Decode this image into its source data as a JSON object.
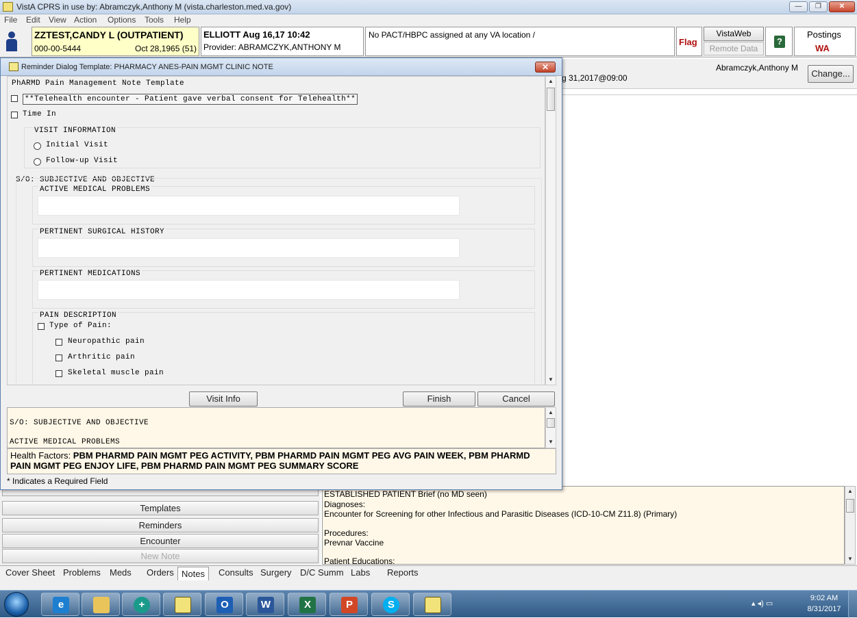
{
  "window": {
    "title": "VistA CPRS in use by: Abramczyk,Anthony M  (vista.charleston.med.va.gov)",
    "controls": [
      "—",
      "❐",
      "✕"
    ]
  },
  "menu": [
    "File",
    "Edit",
    "View",
    "Action",
    "Options",
    "Tools",
    "Help"
  ],
  "patient": {
    "name": "ZZTEST,CANDY L (OUTPATIENT)",
    "ssn": "000-00-5444",
    "dob": "Oct 28,1965 (51)"
  },
  "provider": {
    "line1": "ELLIOTT Aug 16,17 10:42",
    "line2": "Provider:  ABRAMCZYK,ANTHONY M"
  },
  "pact": "No PACT/HBPC assigned at any VA location /",
  "flag": "Flag",
  "vistaweb": "VistaWeb",
  "remote_data": "Remote Data",
  "postings": {
    "label": "Postings",
    "value": "WA"
  },
  "background": {
    "user": "Abramczyk,Anthony M",
    "date_fragment": "g 31,2017@09:00",
    "change_button": "Change..."
  },
  "dialog": {
    "title": "Reminder Dialog Template: PHARMACY ANES-PAIN MGMT CLINIC NOTE",
    "template_title": "PhARMD Pain Management Note Template",
    "telehealth": "**Telehealth encounter - Patient gave verbal consent for Telehealth**",
    "time_in": "Time In",
    "visit_info_group": "VISIT INFORMATION",
    "initial_visit": "Initial Visit",
    "followup_visit": "Follow-up Visit",
    "so_header": "S/O: SUBJECTIVE AND OBJECTIVE",
    "active_problems": "ACTIVE MEDICAL PROBLEMS",
    "surgical_history": "PERTINENT SURGICAL HISTORY",
    "medications": "PERTINENT MEDICATIONS",
    "pain_description": "PAIN DESCRIPTION",
    "type_of_pain": "Type of Pain:",
    "pain_types": [
      "Neuropathic pain",
      "Arthritic pain",
      "Skeletal muscle pain"
    ],
    "buttons": {
      "visit_info": "Visit Info",
      "finish": "Finish",
      "cancel": "Cancel"
    },
    "preview_line1": "S/O: SUBJECTIVE AND OBJECTIVE",
    "preview_line2": "ACTIVE MEDICAL PROBLEMS",
    "health_factors_label": "Health Factors:",
    "health_factors": "PBM PHARMD PAIN MGMT PEG ACTIVITY, PBM PHARMD PAIN MGMT PEG AVG PAIN WEEK, PBM PHARMD PAIN MGMT PEG ENJOY LIFE, PBM PHARMD PAIN MGMT PEG SUMMARY SCORE",
    "required_note": "* Indicates a Required Field"
  },
  "left_buttons": {
    "templates": "Templates",
    "reminders": "Reminders",
    "encounter": "Encounter",
    "new_note": "New Note"
  },
  "encounter": {
    "line1": "ESTABLISHED PATIENT Brief (no MD seen)",
    "diagnoses_label": "Diagnoses:",
    "diagnosis": "Encounter for Screening for other Infectious and Parasitic Diseases (ICD-10-CM Z11.8) (Primary)",
    "procedures_label": "Procedures:",
    "procedure": "Prevnar Vaccine",
    "educations": "Patient Educations:"
  },
  "tabs": [
    "Cover Sheet",
    "Problems",
    "Meds",
    "Orders",
    "Notes",
    "Consults",
    "Surgery",
    "D/C Summ",
    "Labs",
    "Reports"
  ],
  "selected_tab": "Notes",
  "taskbar": {
    "time": "9:02 AM",
    "date": "8/31/2017",
    "apps": [
      "internet-explorer",
      "file-explorer",
      "cprs-app",
      "notepad",
      "outlook",
      "word",
      "excel",
      "powerpoint",
      "skype",
      "notes-app"
    ]
  }
}
